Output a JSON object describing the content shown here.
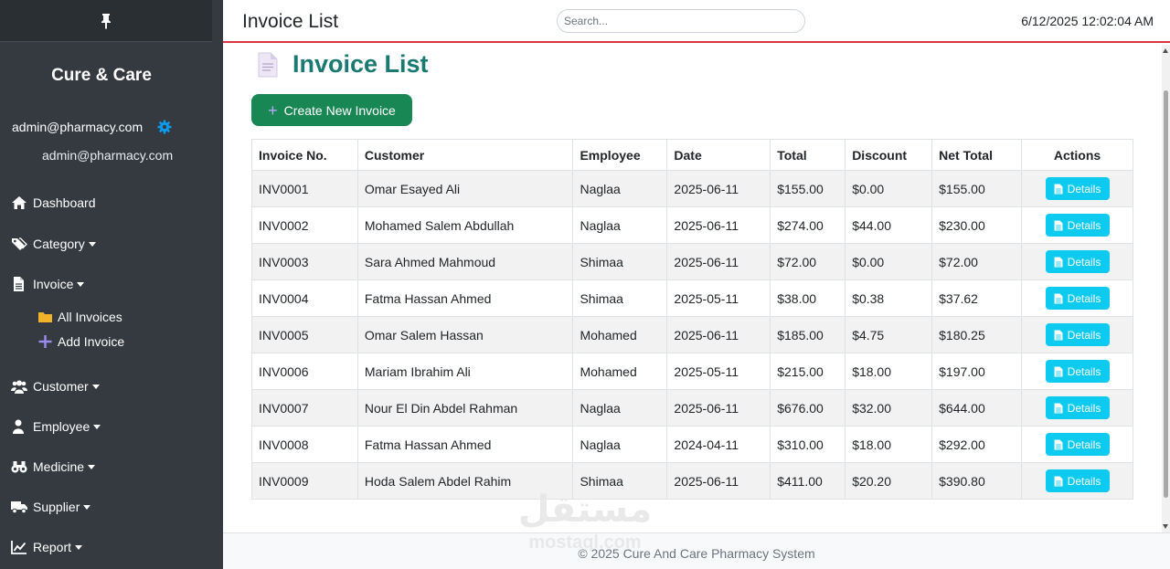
{
  "sidebar": {
    "brand": "Cure & Care",
    "user_email": "admin@pharmacy.com",
    "user_email_secondary": "admin@pharmacy.com",
    "nav": {
      "dashboard": "Dashboard",
      "category": "Category",
      "invoice": "Invoice",
      "all_invoices": "All Invoices",
      "add_invoice": "Add Invoice",
      "customer": "Customer",
      "employee": "Employee",
      "medicine": "Medicine",
      "supplier": "Supplier",
      "report": "Report"
    }
  },
  "header": {
    "title": "Invoice List",
    "search_placeholder": "Search...",
    "datetime": "6/12/2025 12:02:04 AM"
  },
  "main": {
    "heading": "Invoice List",
    "create_button": "Create New Invoice",
    "table": {
      "headers": [
        "Invoice No.",
        "Customer",
        "Employee",
        "Date",
        "Total",
        "Discount",
        "Net Total",
        "Actions"
      ],
      "details_label": "Details",
      "rows": [
        [
          "INV0001",
          "Omar Esayed Ali",
          "Naglaa",
          "2025-06-11",
          "$155.00",
          "$0.00",
          "$155.00"
        ],
        [
          "INV0002",
          "Mohamed Salem Abdullah",
          "Naglaa",
          "2025-06-11",
          "$274.00",
          "$44.00",
          "$230.00"
        ],
        [
          "INV0003",
          "Sara Ahmed Mahmoud",
          "Shimaa",
          "2025-06-11",
          "$72.00",
          "$0.00",
          "$72.00"
        ],
        [
          "INV0004",
          "Fatma Hassan Ahmed",
          "Shimaa",
          "2025-05-11",
          "$38.00",
          "$0.38",
          "$37.62"
        ],
        [
          "INV0005",
          "Omar Salem Hassan",
          "Mohamed",
          "2025-06-11",
          "$185.00",
          "$4.75",
          "$180.25"
        ],
        [
          "INV0006",
          "Mariam Ibrahim Ali",
          "Mohamed",
          "2025-05-11",
          "$215.00",
          "$18.00",
          "$197.00"
        ],
        [
          "INV0007",
          "Nour El Din Abdel Rahman",
          "Naglaa",
          "2025-06-11",
          "$676.00",
          "$32.00",
          "$644.00"
        ],
        [
          "INV0008",
          "Fatma Hassan Ahmed",
          "Naglaa",
          "2024-04-11",
          "$310.00",
          "$18.00",
          "$292.00"
        ],
        [
          "INV0009",
          "Hoda Salem Abdel Rahim",
          "Shimaa",
          "2025-06-11",
          "$411.00",
          "$20.20",
          "$390.80"
        ]
      ]
    }
  },
  "footer": {
    "text": "© 2025 Cure And Care Pharmacy System"
  },
  "watermark": {
    "arabic": "مستقل",
    "latin": "mostaql.com"
  },
  "icons": {
    "pin": "pin-icon",
    "gear": "gear-icon",
    "dashboard": "home-icon",
    "category": "tags-icon",
    "invoice": "file-icon",
    "all_invoices": "folder-icon",
    "add_invoice": "plus-icon",
    "customer": "users-icon",
    "employee": "user-icon",
    "medicine": "binoculars-icon",
    "supplier": "truck-icon",
    "report": "chart-line-icon",
    "heading": "document-icon",
    "details": "file-text-icon"
  },
  "colors": {
    "sidebar_bg": "#343a40",
    "header_border": "#dc3545",
    "heading": "#1a7a72",
    "create_button": "#198754",
    "details_button": "#0dcaf0",
    "gear": "#0d9bf0",
    "folder": "#f0b32a",
    "plus": "#9d8cf0"
  }
}
